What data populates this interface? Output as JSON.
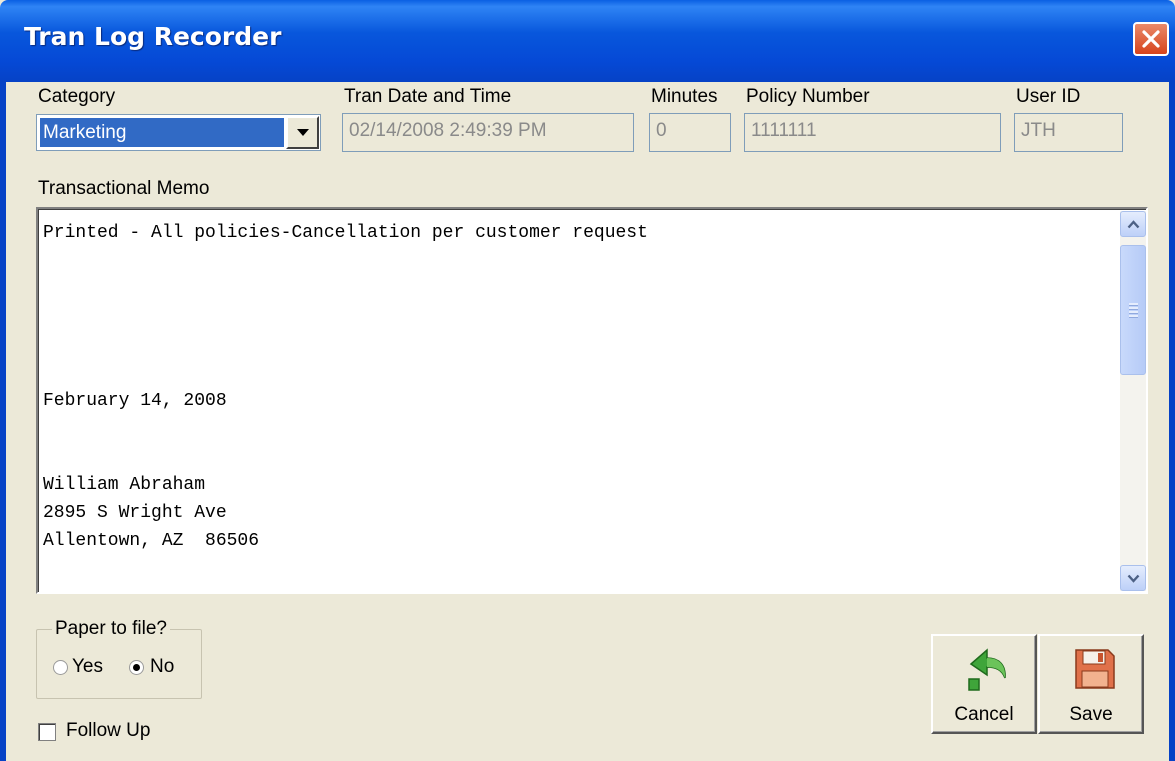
{
  "window": {
    "title": "Tran Log Recorder",
    "close_icon": "close-icon"
  },
  "header_fields": {
    "category": {
      "label": "Category",
      "value": "Marketing"
    },
    "tran_datetime": {
      "label": "Tran Date and Time",
      "value": "02/14/2008 2:49:39 PM"
    },
    "minutes": {
      "label": "Minutes",
      "value": "0"
    },
    "policy_number": {
      "label": "Policy Number",
      "value": "1111111"
    },
    "user_id": {
      "label": "User ID",
      "value": "JTH"
    }
  },
  "memo": {
    "label": "Transactional Memo",
    "lines": [
      "Printed - All policies-Cancellation per customer request",
      "",
      "",
      "",
      "",
      "",
      "February 14, 2008",
      "",
      "",
      "William Abraham",
      "2895 S Wright Ave",
      "Allentown, AZ  86506"
    ]
  },
  "paper_to_file": {
    "label": "Paper to file?",
    "yes_label": "Yes",
    "no_label": "No",
    "selected": "No"
  },
  "follow_up": {
    "label": "Follow Up",
    "checked": false
  },
  "buttons": {
    "cancel_label": "Cancel",
    "save_label": "Save"
  },
  "colors": {
    "title_bar": "#0549d6",
    "selection": "#316ac5",
    "dialog_bg": "#ece9d8"
  }
}
